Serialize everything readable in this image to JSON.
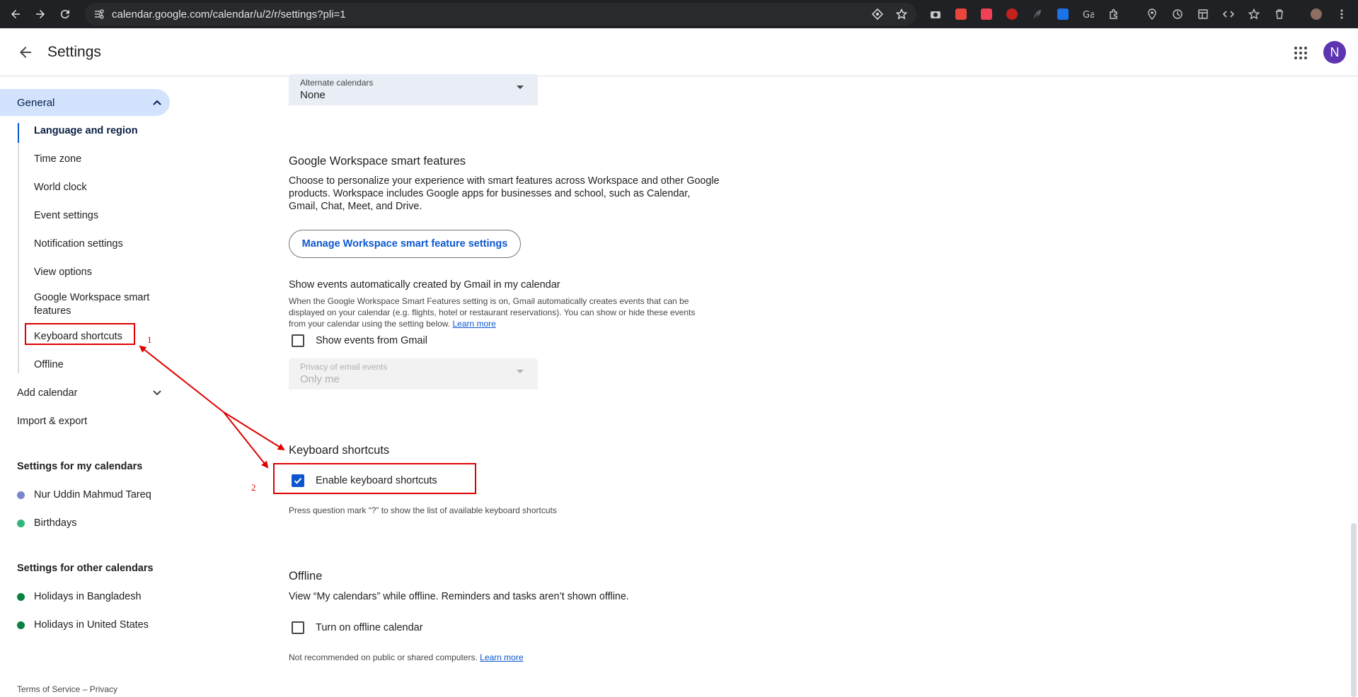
{
  "browser": {
    "url": "calendar.google.com/calendar/u/2/r/settings?pli=1"
  },
  "header": {
    "title": "Settings",
    "avatar_initial": "N"
  },
  "sidebar": {
    "general": "General",
    "sub_items": [
      "Language and region",
      "Time zone",
      "World clock",
      "Event settings",
      "Notification settings",
      "View options",
      "Google Workspace smart features",
      "Keyboard shortcuts",
      "Offline"
    ],
    "add_calendar": "Add calendar",
    "import_export": "Import & export",
    "my_calendars_heading": "Settings for my calendars",
    "my_calendars": [
      {
        "name": "Nur Uddin Mahmud Tareq",
        "color": "#7986cb"
      },
      {
        "name": "Birthdays",
        "color": "#33b679"
      }
    ],
    "other_calendars_heading": "Settings for other calendars",
    "other_calendars": [
      {
        "name": "Holidays in Bangladesh",
        "color": "#0b8043"
      },
      {
        "name": "Holidays in United States",
        "color": "#0b8043"
      }
    ],
    "footer": "Terms of Service – Privacy"
  },
  "main": {
    "alternate_calendars": {
      "label": "Alternate calendars",
      "value": "None"
    },
    "workspace": {
      "title": "Google Workspace smart features",
      "description": "Choose to personalize your experience with smart features across Workspace and other Google products. Workspace includes Google apps for businesses and school, such as Calendar, Gmail, Chat, Meet, and Drive.",
      "button": "Manage Workspace smart feature settings"
    },
    "gmail_events": {
      "title": "Show events automatically created by Gmail in my calendar",
      "description": "When the Google Workspace Smart Features setting is on, Gmail automatically creates events that can be displayed on your calendar (e.g. flights, hotel or restaurant reservations). You can show or hide these events from your calendar using the setting below.",
      "learn_more": "Learn more",
      "checkbox": "Show events from Gmail",
      "privacy": {
        "label": "Privacy of email events",
        "value": "Only me"
      }
    },
    "keyboard": {
      "title": "Keyboard shortcuts",
      "checkbox": "Enable keyboard shortcuts",
      "checked": true,
      "hint": "Press question mark “?” to show the list of available keyboard shortcuts"
    },
    "offline": {
      "title": "Offline",
      "description": "View “My calendars” while offline. Reminders and tasks aren’t shown offline.",
      "checkbox": "Turn on offline calendar",
      "note": "Not recommended on public or shared computers.",
      "learn_more": "Learn more"
    }
  },
  "annotations": {
    "label_1": "1",
    "label_2": "2",
    "color": "#e00000"
  }
}
